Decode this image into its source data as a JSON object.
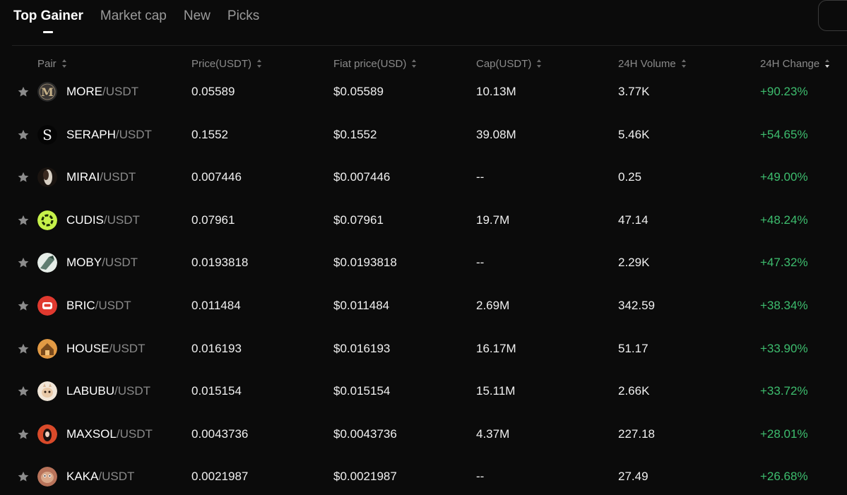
{
  "tabs": [
    {
      "label": "Top Gainer",
      "active": true
    },
    {
      "label": "Market cap",
      "active": false
    },
    {
      "label": "New",
      "active": false
    },
    {
      "label": "Picks",
      "active": false
    }
  ],
  "columns": {
    "pair": "Pair",
    "price": "Price(USDT)",
    "fiat": "Fiat price(USD)",
    "cap": "Cap(USDT)",
    "volume": "24H Volume",
    "change": "24H Change"
  },
  "colors": {
    "background": "#0b0b0b",
    "positive": "#3dbd6e",
    "muted": "#8a8a8a"
  },
  "rows": [
    {
      "base": "MORE",
      "quote": "/USDT",
      "price": "0.05589",
      "fiat": "$0.05589",
      "cap": "10.13M",
      "volume": "3.77K",
      "change": "+90.23%",
      "icon": "more-coin-icon"
    },
    {
      "base": "SERAPH",
      "quote": "/USDT",
      "price": "0.1552",
      "fiat": "$0.1552",
      "cap": "39.08M",
      "volume": "5.46K",
      "change": "+54.65%",
      "icon": "seraph-coin-icon"
    },
    {
      "base": "MIRAI",
      "quote": "/USDT",
      "price": "0.007446",
      "fiat": "$0.007446",
      "cap": "--",
      "volume": "0.25",
      "change": "+49.00%",
      "icon": "mirai-coin-icon"
    },
    {
      "base": "CUDIS",
      "quote": "/USDT",
      "price": "0.07961",
      "fiat": "$0.07961",
      "cap": "19.7M",
      "volume": "47.14",
      "change": "+48.24%",
      "icon": "cudis-coin-icon"
    },
    {
      "base": "MOBY",
      "quote": "/USDT",
      "price": "0.0193818",
      "fiat": "$0.0193818",
      "cap": "--",
      "volume": "2.29K",
      "change": "+47.32%",
      "icon": "moby-coin-icon"
    },
    {
      "base": "BRIC",
      "quote": "/USDT",
      "price": "0.011484",
      "fiat": "$0.011484",
      "cap": "2.69M",
      "volume": "342.59",
      "change": "+38.34%",
      "icon": "bric-coin-icon"
    },
    {
      "base": "HOUSE",
      "quote": "/USDT",
      "price": "0.016193",
      "fiat": "$0.016193",
      "cap": "16.17M",
      "volume": "51.17",
      "change": "+33.90%",
      "icon": "house-coin-icon"
    },
    {
      "base": "LABUBU",
      "quote": "/USDT",
      "price": "0.015154",
      "fiat": "$0.015154",
      "cap": "15.11M",
      "volume": "2.66K",
      "change": "+33.72%",
      "icon": "labubu-coin-icon"
    },
    {
      "base": "MAXSOL",
      "quote": "/USDT",
      "price": "0.0043736",
      "fiat": "$0.0043736",
      "cap": "4.37M",
      "volume": "227.18",
      "change": "+28.01%",
      "icon": "maxsol-coin-icon"
    },
    {
      "base": "KAKA",
      "quote": "/USDT",
      "price": "0.0021987",
      "fiat": "$0.0021987",
      "cap": "--",
      "volume": "27.49",
      "change": "+26.68%",
      "icon": "kaka-coin-icon"
    }
  ]
}
